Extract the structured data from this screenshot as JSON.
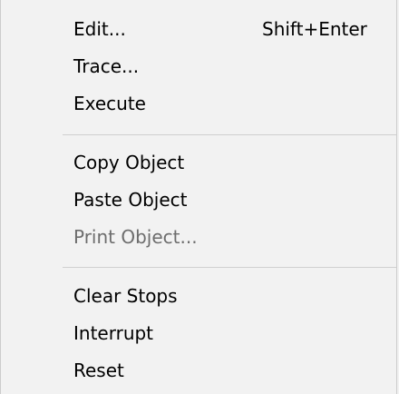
{
  "menu": {
    "groups": [
      {
        "items": [
          {
            "label": "Edit...",
            "shortcut": "Shift+Enter",
            "enabled": true
          },
          {
            "label": "Trace...",
            "shortcut": "",
            "enabled": true
          },
          {
            "label": "Execute",
            "shortcut": "",
            "enabled": true
          }
        ]
      },
      {
        "items": [
          {
            "label": "Copy Object",
            "shortcut": "",
            "enabled": true
          },
          {
            "label": "Paste Object",
            "shortcut": "",
            "enabled": true
          },
          {
            "label": "Print Object...",
            "shortcut": "",
            "enabled": false
          }
        ]
      },
      {
        "items": [
          {
            "label": "Clear Stops",
            "shortcut": "",
            "enabled": true
          },
          {
            "label": "Interrupt",
            "shortcut": "",
            "enabled": true
          },
          {
            "label": "Reset",
            "shortcut": "",
            "enabled": true
          }
        ]
      }
    ]
  }
}
